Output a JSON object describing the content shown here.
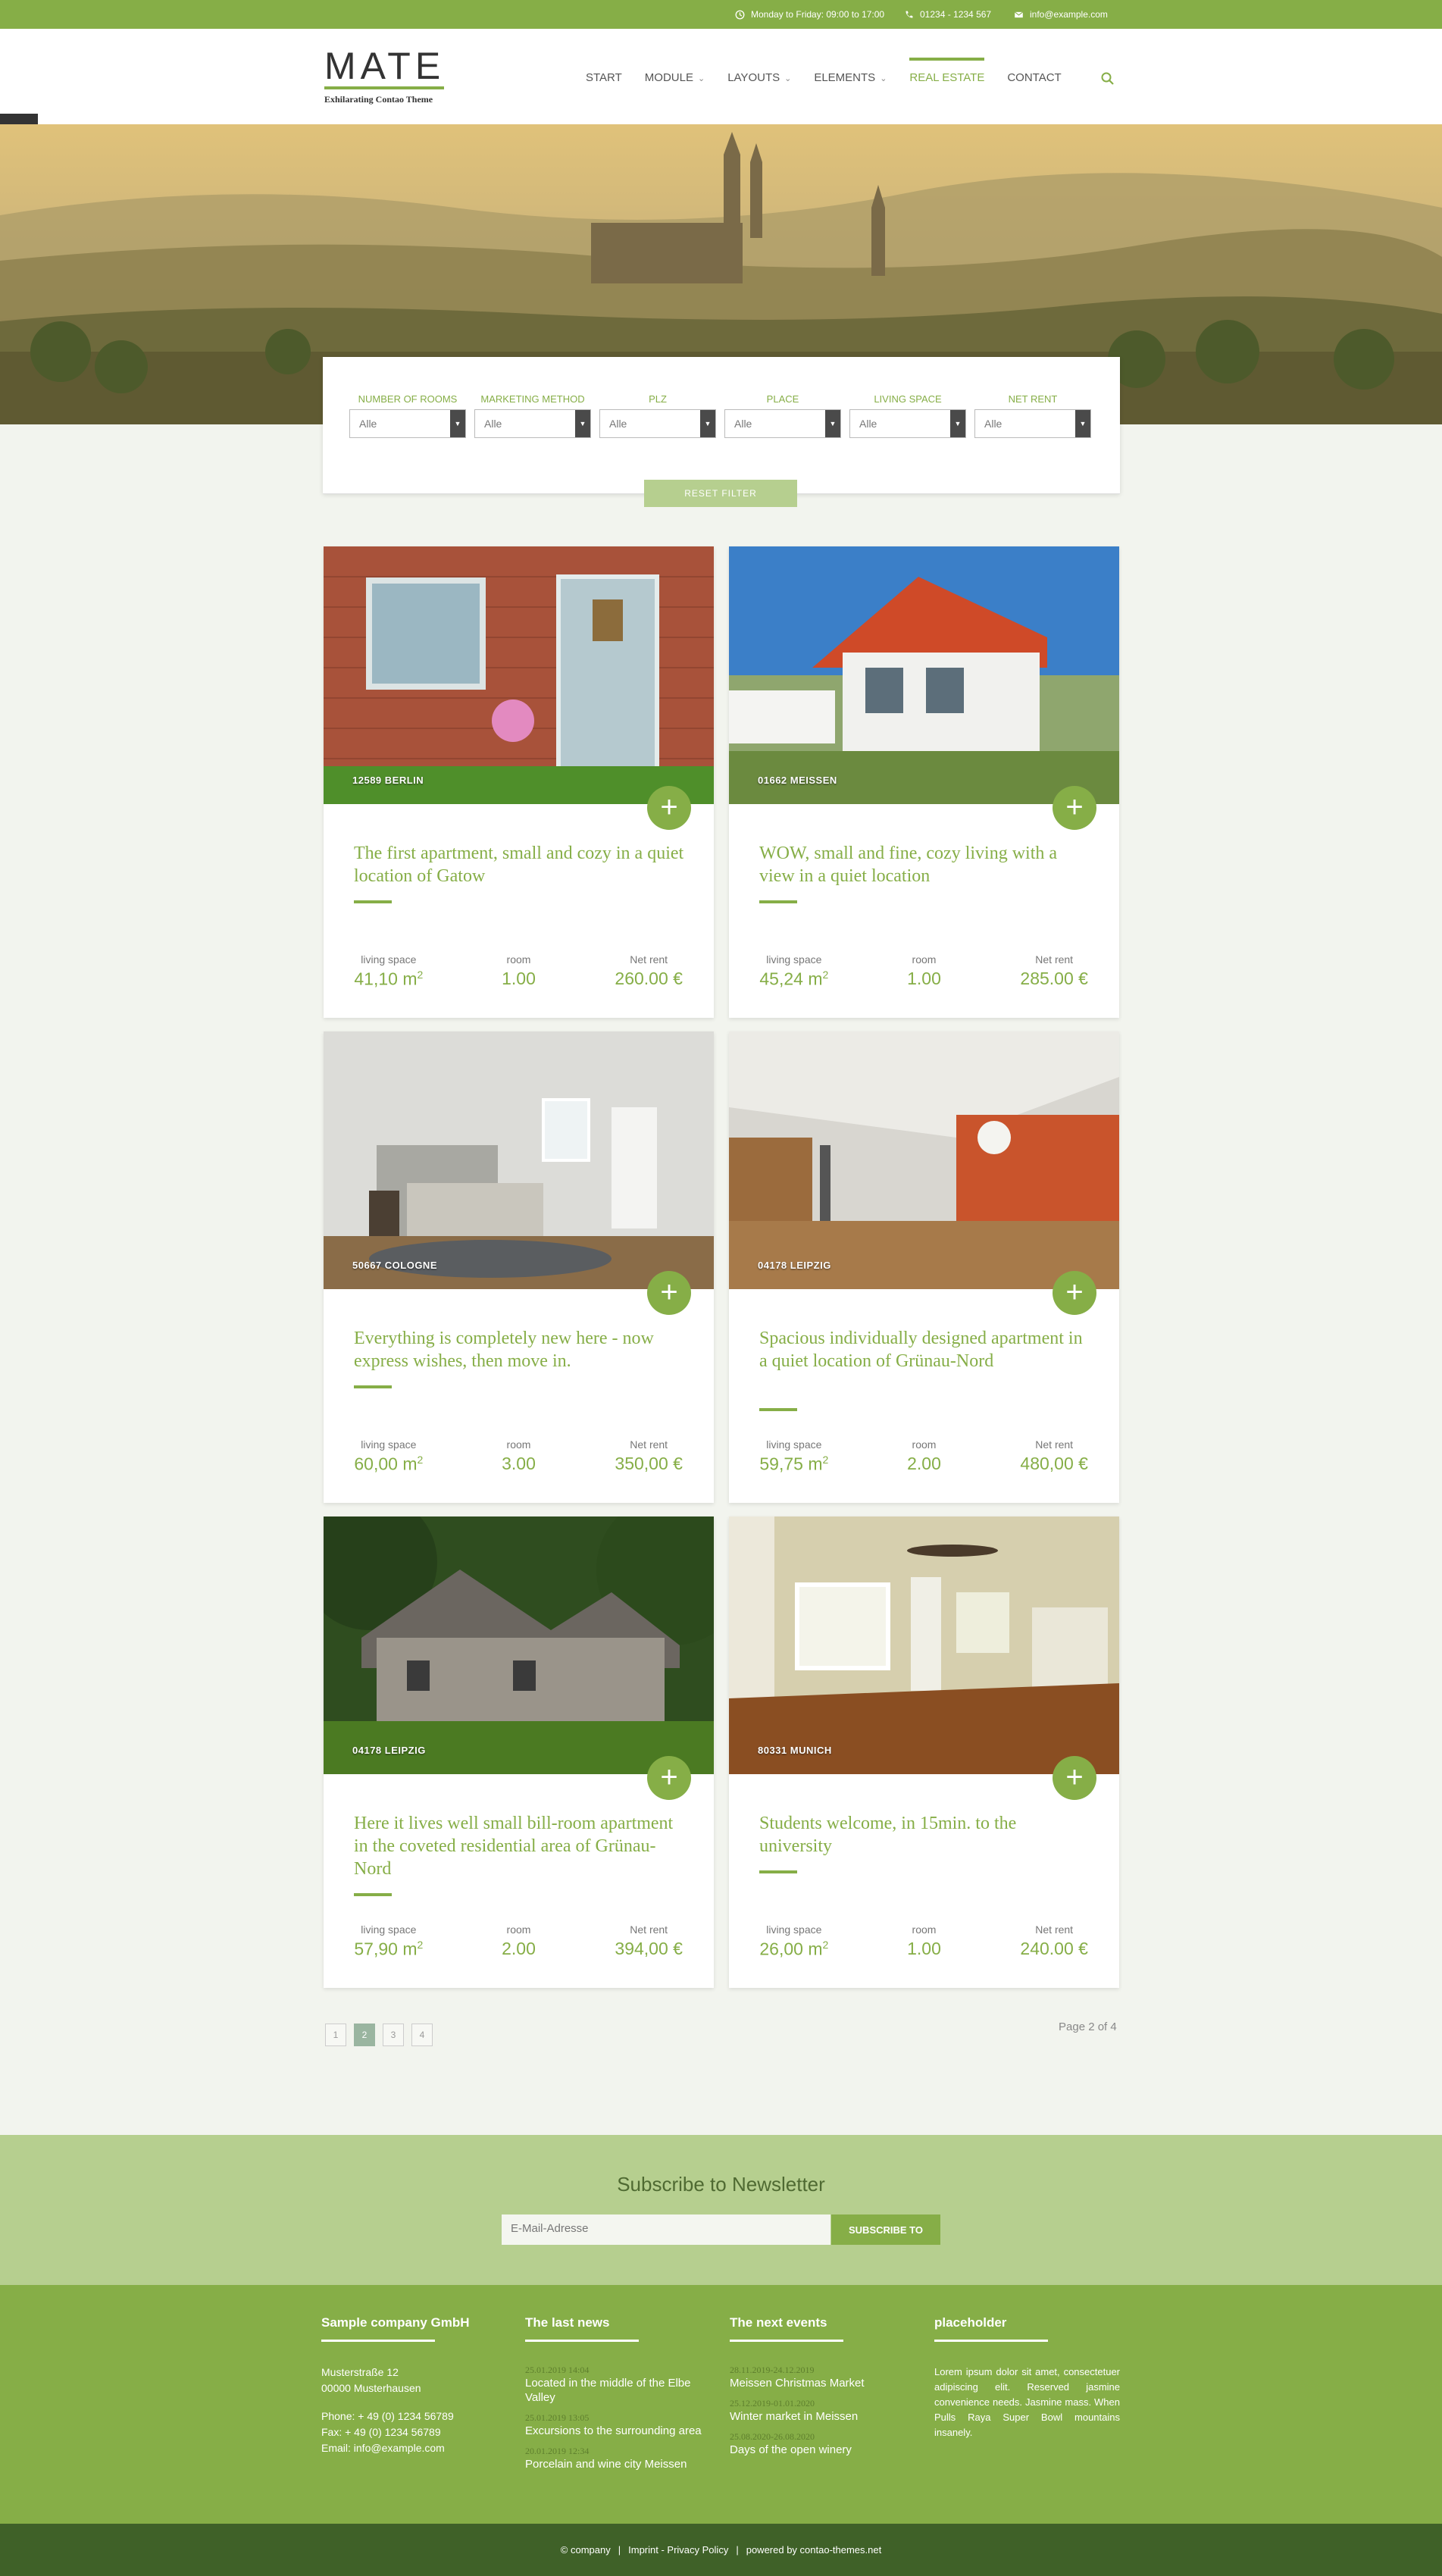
{
  "topbar": {
    "hours": "Monday to Friday: 09:00 to 17:00",
    "phone": "01234 - 1234 567",
    "email": "info@example.com"
  },
  "header": {
    "logo_word": "MATE",
    "logo_tagline": "Exhilarating Contao Theme",
    "nav": [
      {
        "label": "START",
        "dropdown": false
      },
      {
        "label": "MODULE",
        "dropdown": true
      },
      {
        "label": "LAYOUTS",
        "dropdown": true
      },
      {
        "label": "ELEMENTS",
        "dropdown": true
      },
      {
        "label": "REAL ESTATE",
        "dropdown": false,
        "active": true
      },
      {
        "label": "CONTACT",
        "dropdown": false
      }
    ]
  },
  "filter": {
    "fields": [
      {
        "label": "NUMBER OF ROOMS",
        "value": "Alle"
      },
      {
        "label": "MARKETING METHOD",
        "value": "Alle"
      },
      {
        "label": "PLZ",
        "value": "Alle"
      },
      {
        "label": "PLACE",
        "value": "Alle"
      },
      {
        "label": "LIVING SPACE",
        "value": "Alle"
      },
      {
        "label": "NET RENT",
        "value": "Alle"
      }
    ],
    "reset_label": "RESET FILTER"
  },
  "listing_labels": {
    "living_space": "living space",
    "room": "room",
    "net_rent": "Net rent"
  },
  "listings": [
    {
      "location": "12589 BERLIN",
      "title": "The first apartment, small and cozy in a quiet location of Gatow",
      "living_space": "41,10 m",
      "room": "1.00",
      "net_rent": "260.00 €"
    },
    {
      "location": "01662 MEISSEN",
      "title": "WOW, small and fine, cozy living with a view in a quiet location",
      "living_space": "45,24 m",
      "room": "1.00",
      "net_rent": "285.00 €"
    },
    {
      "location": "50667 COLOGNE",
      "title": "Everything is completely new here - now express wishes, then move in.",
      "living_space": "60,00 m",
      "room": "3.00",
      "net_rent": "350,00 €"
    },
    {
      "location": "04178 LEIPZIG",
      "title": "Spacious individually designed apartment in a quiet location of Grünau-Nord",
      "living_space": "59,75 m",
      "room": "2.00",
      "net_rent": "480,00 €"
    },
    {
      "location": "04178 LEIPZIG",
      "title": "Here it lives well small bill-room apartment in the coveted residential area of Grünau-Nord",
      "living_space": "57,90 m",
      "room": "2.00",
      "net_rent": "394,00 €"
    },
    {
      "location": "80331 MUNICH",
      "title": "Students welcome, in 15min. to the university",
      "living_space": "26,00 m",
      "room": "1.00",
      "net_rent": "240.00 €"
    }
  ],
  "pagination": {
    "pages": [
      "1",
      "2",
      "3",
      "4"
    ],
    "current": "2",
    "info": "Page 2 of 4"
  },
  "newsletter": {
    "heading": "Subscribe to Newsletter",
    "placeholder": "E-Mail-Adresse",
    "button": "SUBSCRIBE TO"
  },
  "footer": {
    "company": {
      "heading": "Sample company GmbH",
      "street": "Musterstraße 12",
      "city": "00000 Musterhausen",
      "phone": "Phone: + 49 (0) 1234 56789",
      "fax": "Fax: + 49 (0) 1234 56789",
      "email": "Email: info@example.com"
    },
    "news": {
      "heading": "The last news",
      "items": [
        {
          "date": "25.01.2019 14:04",
          "title": "Located in the middle of the Elbe Valley"
        },
        {
          "date": "25.01.2019 13:05",
          "title": "Excursions to the surrounding area"
        },
        {
          "date": "20.01.2019 12:34",
          "title": "Porcelain and wine city Meissen"
        }
      ]
    },
    "events": {
      "heading": "The next events",
      "items": [
        {
          "date": "28.11.2019-24.12.2019",
          "title": "Meissen Christmas Market"
        },
        {
          "date": "25.12.2019-01.01.2020",
          "title": "Winter market in Meissen"
        },
        {
          "date": "25.08.2020-26.08.2020",
          "title": "Days of the open winery"
        }
      ]
    },
    "placeholder": {
      "heading": "placeholder",
      "text": "Lorem ipsum dolor sit amet, consectetuer adipiscing elit. Reserved jasmine convenience needs. Jasmine mass. When Pulls Raya Super Bowl mountains insanely."
    }
  },
  "bottom": {
    "copyright": "© company",
    "imprint": "Imprint - Privacy Policy",
    "powered": "powered by contao-themes.net"
  },
  "colors": {
    "accent": "#86ae47",
    "accent_light": "#b6cf8f",
    "dark_green": "#3f6128",
    "background": "#f2f4ee"
  }
}
